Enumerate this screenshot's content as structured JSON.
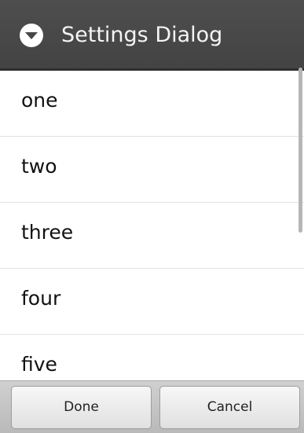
{
  "dialog": {
    "title": "Settings Dialog",
    "icon": "chevron-down-circle-icon"
  },
  "list": {
    "items": [
      {
        "label": "one"
      },
      {
        "label": "two"
      },
      {
        "label": "three"
      },
      {
        "label": "four"
      },
      {
        "label": "five"
      }
    ]
  },
  "buttons": {
    "done_label": "Done",
    "cancel_label": "Cancel"
  },
  "colors": {
    "title_bar": "#474747",
    "title_text": "#f4f4f4",
    "button_bar": "#c4c4c4"
  }
}
